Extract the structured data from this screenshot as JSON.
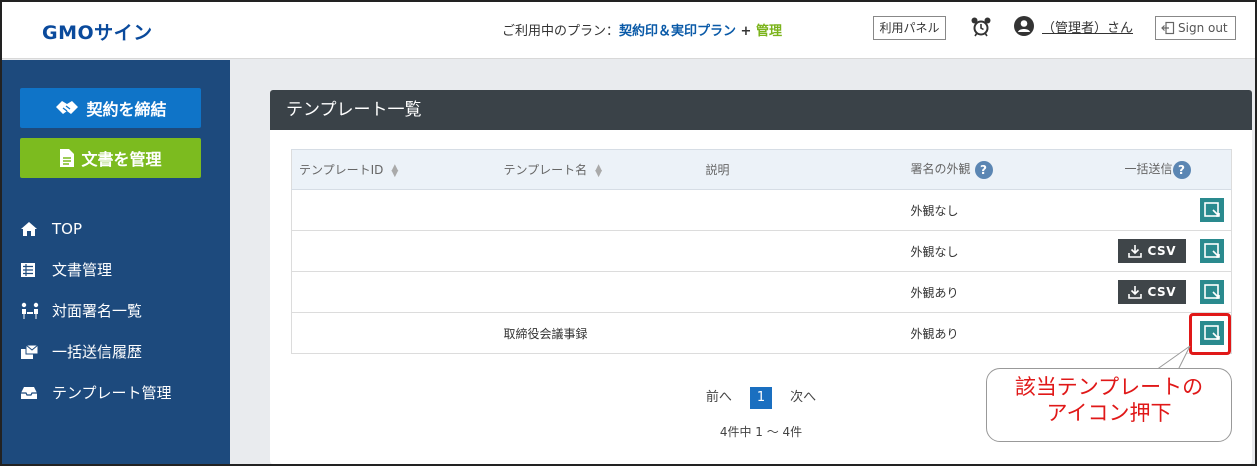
{
  "header": {
    "logo": "GMOサイン",
    "plan_prefix": "ご利用中のプラン：",
    "plan_name": "契約印＆実印プラン",
    "plan_plus": " + ",
    "plan_role": "管理",
    "panel_button": "利用パネル",
    "user_name": "（管理者）さん",
    "signout": "Sign out"
  },
  "sidebar": {
    "contract_button": "契約を締結",
    "docs_button": "文書を管理",
    "items": [
      {
        "label": "TOP",
        "icon": "home-icon"
      },
      {
        "label": "文書管理",
        "icon": "document-list-icon"
      },
      {
        "label": "対面署名一覧",
        "icon": "face-to-face-icon"
      },
      {
        "label": "一括送信履歴",
        "icon": "bulk-send-icon"
      },
      {
        "label": "テンプレート管理",
        "icon": "tray-icon"
      }
    ]
  },
  "main": {
    "title": "テンプレート一覧",
    "columns": {
      "id": "テンプレートID",
      "name": "テンプレート名",
      "desc": "説明",
      "appearance": "署名の外観",
      "bulk": "一括送信"
    },
    "rows": [
      {
        "id": "",
        "name": "",
        "desc": "",
        "appearance": "外観なし",
        "csv": false
      },
      {
        "id": "",
        "name": "",
        "desc": "",
        "appearance": "外観なし",
        "csv": true
      },
      {
        "id": "",
        "name": "",
        "desc": "",
        "appearance": "外観あり",
        "csv": true
      },
      {
        "id": "",
        "name": "取締役会議事録",
        "desc": "",
        "appearance": "外観あり",
        "csv": false
      }
    ],
    "csv_label": "CSV",
    "help_mark": "?",
    "pager": {
      "prev": "前へ",
      "current": "1",
      "next": "次へ"
    },
    "count_text": "4件中 1 ～ 4件"
  },
  "callout": {
    "line1": "該当テンプレートの",
    "line2": "アイコン押下"
  },
  "colors": {
    "sidebar_bg": "#1d4a7d",
    "contract_btn": "#0f74c8",
    "docs_btn": "#7cbb1f",
    "send_icon": "#2a8a8e",
    "highlight": "#e01818"
  }
}
